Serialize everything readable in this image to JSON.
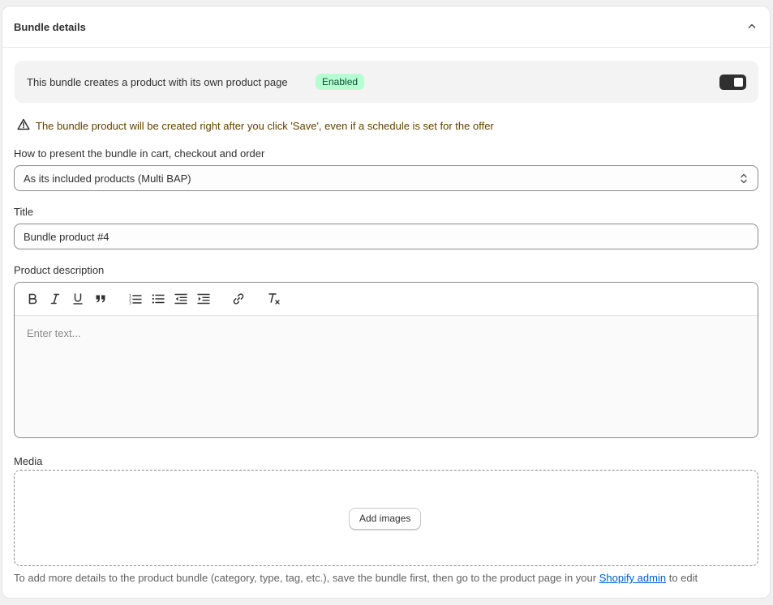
{
  "card": {
    "title": "Bundle details"
  },
  "product_page": {
    "text": "This bundle creates a product with its own product page",
    "badge": "Enabled",
    "toggle_on": true
  },
  "warning": {
    "text": "The bundle product will be created right after you click 'Save', even if a schedule is set for the offer"
  },
  "presentation": {
    "label": "How to present the bundle in cart, checkout and order",
    "selected": "As its included products (Multi BAP)"
  },
  "title_field": {
    "label": "Title",
    "value": "Bundle product #4"
  },
  "description": {
    "label": "Product description",
    "placeholder": "Enter text...",
    "toolbar": [
      "bold-icon",
      "italic-icon",
      "underline-icon",
      "quote-icon",
      "ordered-list-icon",
      "bullet-list-icon",
      "outdent-icon",
      "indent-icon",
      "link-icon",
      "clear-format-icon"
    ]
  },
  "media": {
    "label": "Media",
    "button": "Add images"
  },
  "footer": {
    "text_before": "To add more details to the product bundle (category, type, tag, etc.), save the bundle first, then go to the product page in your ",
    "link": "Shopify admin",
    "text_after": " to edit"
  },
  "colors": {
    "badge_bg": "#b4fed2",
    "badge_text": "#0c5132",
    "warning_text": "#5e4200",
    "link": "#005bd3",
    "toggle": "#303030"
  }
}
